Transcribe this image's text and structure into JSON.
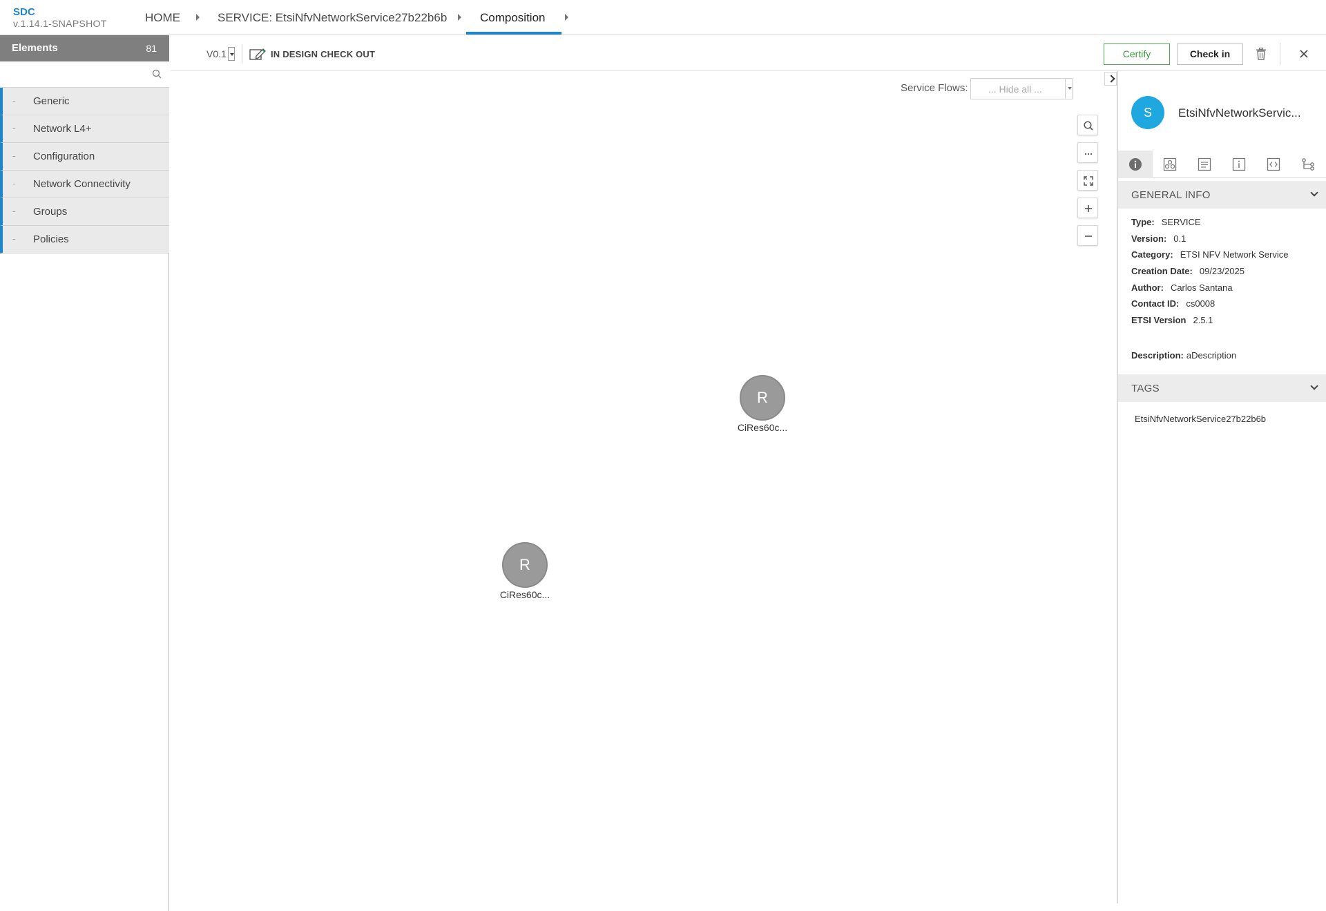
{
  "header": {
    "app_name": "SDC",
    "app_version": "v.1.14.1-SNAPSHOT",
    "breadcrumbs": [
      {
        "label": "HOME"
      },
      {
        "label": "SERVICE: EtsiNfvNetworkService27b22b6b"
      },
      {
        "label": "Composition"
      }
    ]
  },
  "palette": {
    "title": "Elements",
    "count": "81",
    "search_placeholder": "",
    "groups": [
      {
        "dash": "-",
        "label": "Generic"
      },
      {
        "dash": "-",
        "label": "Network L4+"
      },
      {
        "dash": "-",
        "label": "Configuration"
      },
      {
        "dash": "-",
        "label": "Network Connectivity"
      },
      {
        "dash": "-",
        "label": "Groups"
      },
      {
        "dash": "-",
        "label": "Policies"
      }
    ]
  },
  "toolbar": {
    "version": "V0.1",
    "lifecycle_state": "IN DESIGN CHECK OUT",
    "certify_label": "Certify",
    "checkin_label": "Check in"
  },
  "canvas": {
    "service_flows_label": "Service Flows:",
    "service_flows_value": "... Hide all ...",
    "nodes": [
      {
        "letter": "R",
        "label": "CiRes60c..."
      },
      {
        "letter": "R",
        "label": "CiRes60c..."
      }
    ]
  },
  "right_panel": {
    "avatar_letter": "S",
    "component_name": "EtsiNfvNetworkServic...",
    "general_info_title": "GENERAL INFO",
    "info": {
      "type_key": "Type:",
      "type_val": "SERVICE",
      "version_key": "Version:",
      "version_val": "0.1",
      "category_key": "Category:",
      "category_val": "ETSI NFV Network Service",
      "created_key": "Creation Date:",
      "created_val": "09/23/2025",
      "author_key": "Author:",
      "author_val": "Carlos Santana",
      "contact_key": "Contact ID:",
      "contact_val": "cs0008",
      "etsi_key": "ETSI Version",
      "etsi_val": "2.5.1",
      "desc_key": "Description:",
      "desc_val": "aDescription"
    },
    "tags_title": "TAGS",
    "tags": [
      "EtsiNfvNetworkService27b22b6b"
    ]
  },
  "colors": {
    "accent": "#1f86c9",
    "certify_green": "#3b9a3b",
    "avatar_blue": "#1fa7e0",
    "node_gray": "#9a9a9a"
  }
}
